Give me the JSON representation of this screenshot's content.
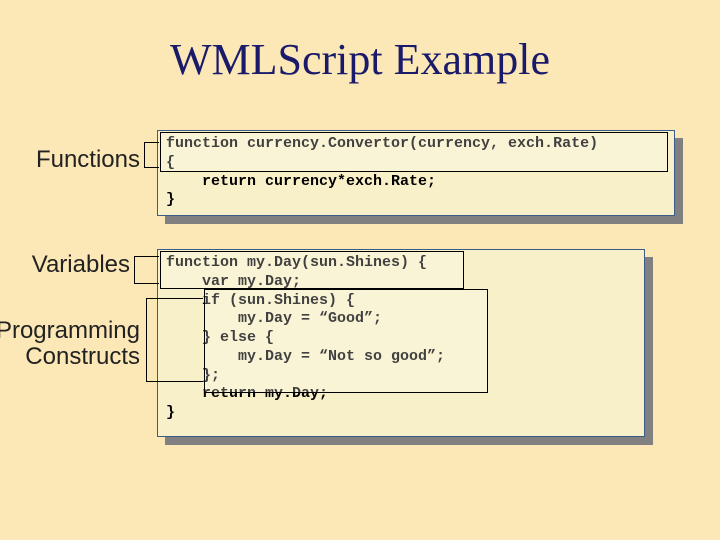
{
  "title": "WMLScript Example",
  "labels": {
    "functions": "Functions",
    "variables": "Variables",
    "programming": "Programming\nConstructs"
  },
  "code": {
    "block1": "function currency.Convertor(currency, exch.Rate)\n{\n    return currency*exch.Rate;\n}",
    "block2": "function my.Day(sun.Shines) {\n    var my.Day;\n    if (sun.Shines) {\n        my.Day = “Good”;\n    } else {\n        my.Day = “Not so good”;\n    };\n    return my.Day;\n}"
  }
}
